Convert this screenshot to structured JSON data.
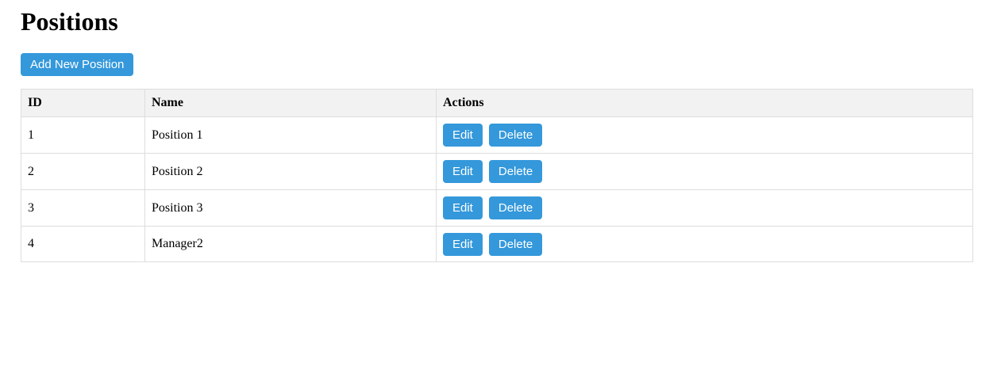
{
  "page": {
    "title": "Positions",
    "add_button_label": "Add New Position"
  },
  "table": {
    "headers": {
      "id": "ID",
      "name": "Name",
      "actions": "Actions"
    },
    "rows": [
      {
        "id": "1",
        "name": "Position 1",
        "edit_label": "Edit",
        "delete_label": "Delete"
      },
      {
        "id": "2",
        "name": "Position 2",
        "edit_label": "Edit",
        "delete_label": "Delete"
      },
      {
        "id": "3",
        "name": "Position 3",
        "edit_label": "Edit",
        "delete_label": "Delete"
      },
      {
        "id": "4",
        "name": "Manager2",
        "edit_label": "Edit",
        "delete_label": "Delete"
      }
    ]
  },
  "colors": {
    "button": "#3498db",
    "header_bg": "#f2f2f2",
    "border": "#dddddd"
  }
}
